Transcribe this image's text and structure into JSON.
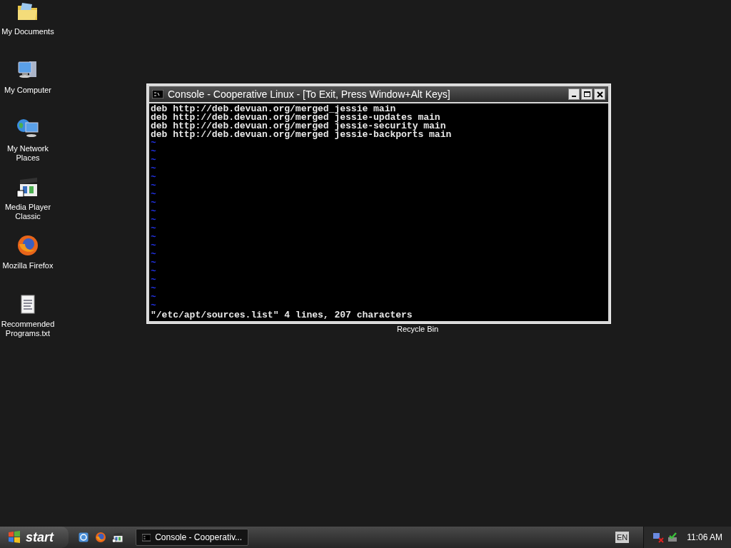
{
  "desktop_icons": [
    {
      "kind": "documents",
      "label": "My Documents"
    },
    {
      "kind": "computer",
      "label": "My Computer"
    },
    {
      "kind": "network",
      "label": "My Network Places"
    },
    {
      "kind": "media",
      "label": "Media Player Classic"
    },
    {
      "kind": "firefox",
      "label": "Mozilla Firefox"
    },
    {
      "kind": "text",
      "label": "Recommended Programs.txt"
    }
  ],
  "recycle_bin": {
    "label": "Recycle Bin"
  },
  "window": {
    "title": "Console - Cooperative Linux - [To Exit, Press Window+Alt Keys]",
    "lines": [
      "deb http://deb.devuan.org/merged_jessie main",
      "deb http://deb.devuan.org/merged jessie-updates main",
      "deb http://deb.devuan.org/merged jessie-security main",
      "deb http://deb.devuan.org/merged jessie-backports main"
    ],
    "tilde_lines": [
      "~",
      "~",
      "~",
      "~",
      "~",
      "~",
      "~",
      "~",
      "~",
      "~",
      "~",
      "~",
      "~",
      "~",
      "~",
      "~",
      "~",
      "~",
      "~",
      "~"
    ],
    "status_line": "\"/etc/apt/sources.list\" 4 lines, 207 characters"
  },
  "taskbar": {
    "start": "start",
    "quick_launch": [
      {
        "kind": "ie"
      },
      {
        "kind": "firefox"
      },
      {
        "kind": "media"
      }
    ],
    "tasks": [
      {
        "label": "Console - Cooperativ...",
        "selected": true
      }
    ],
    "language": "EN",
    "clock": "11:06 AM"
  }
}
